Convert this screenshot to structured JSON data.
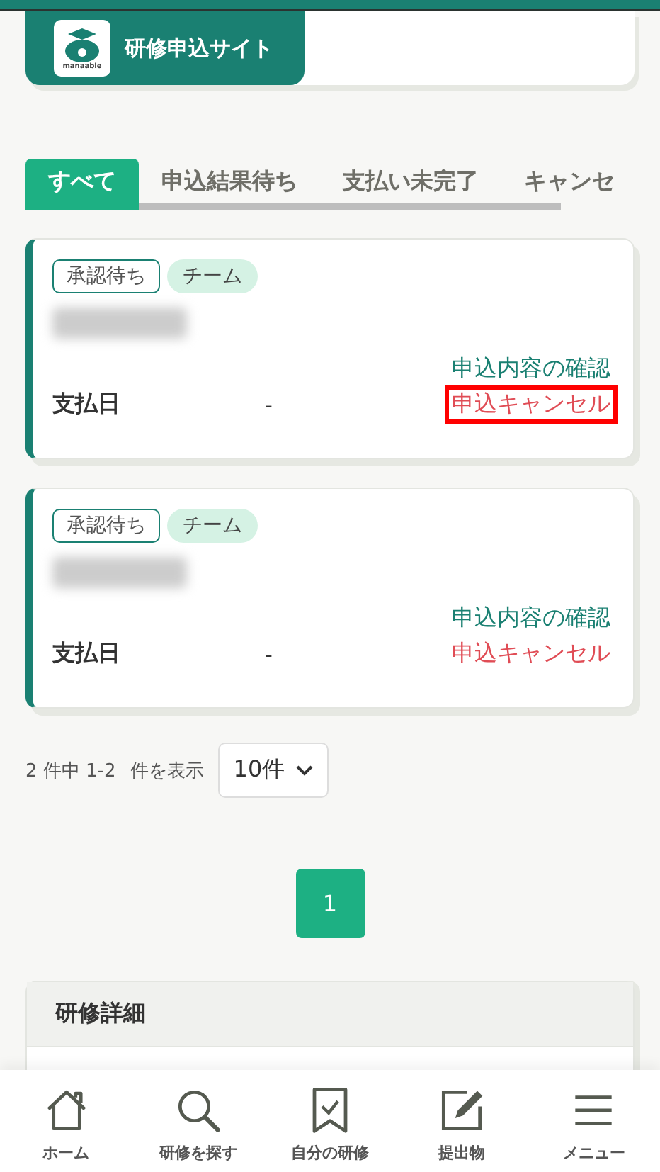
{
  "header": {
    "logo_text": "manaable",
    "site_title": "研修申込サイト"
  },
  "tabs": [
    {
      "label": "すべて",
      "selected": true
    },
    {
      "label": "申込結果待ち",
      "selected": false
    },
    {
      "label": "支払い未完了",
      "selected": false
    },
    {
      "label": "キャンセ",
      "selected": false
    }
  ],
  "applications": [
    {
      "status_tag": "承認待ち",
      "type_tag": "チーム",
      "payment_label": "支払日",
      "payment_value": "-",
      "confirm_link": "申込内容の確認",
      "cancel_link": "申込キャンセル",
      "cancel_highlighted": true
    },
    {
      "status_tag": "承認待ち",
      "type_tag": "チーム",
      "payment_label": "支払日",
      "payment_value": "-",
      "confirm_link": "申込内容の確認",
      "cancel_link": "申込キャンセル",
      "cancel_highlighted": false
    }
  ],
  "result_info": {
    "range_text": "2 件中 1-2",
    "suffix": "件を表示",
    "per_page": "10件"
  },
  "pagination": [
    {
      "label": "1",
      "selected": true
    }
  ],
  "detail_panel": {
    "title": "研修詳細"
  },
  "bottom_nav": [
    {
      "kind": "home",
      "label": "ホーム"
    },
    {
      "kind": "search",
      "label": "研修を探す"
    },
    {
      "kind": "bookmark",
      "label": "自分の研修"
    },
    {
      "kind": "edit",
      "label": "提出物"
    },
    {
      "kind": "menu",
      "label": "メニュー"
    }
  ]
}
